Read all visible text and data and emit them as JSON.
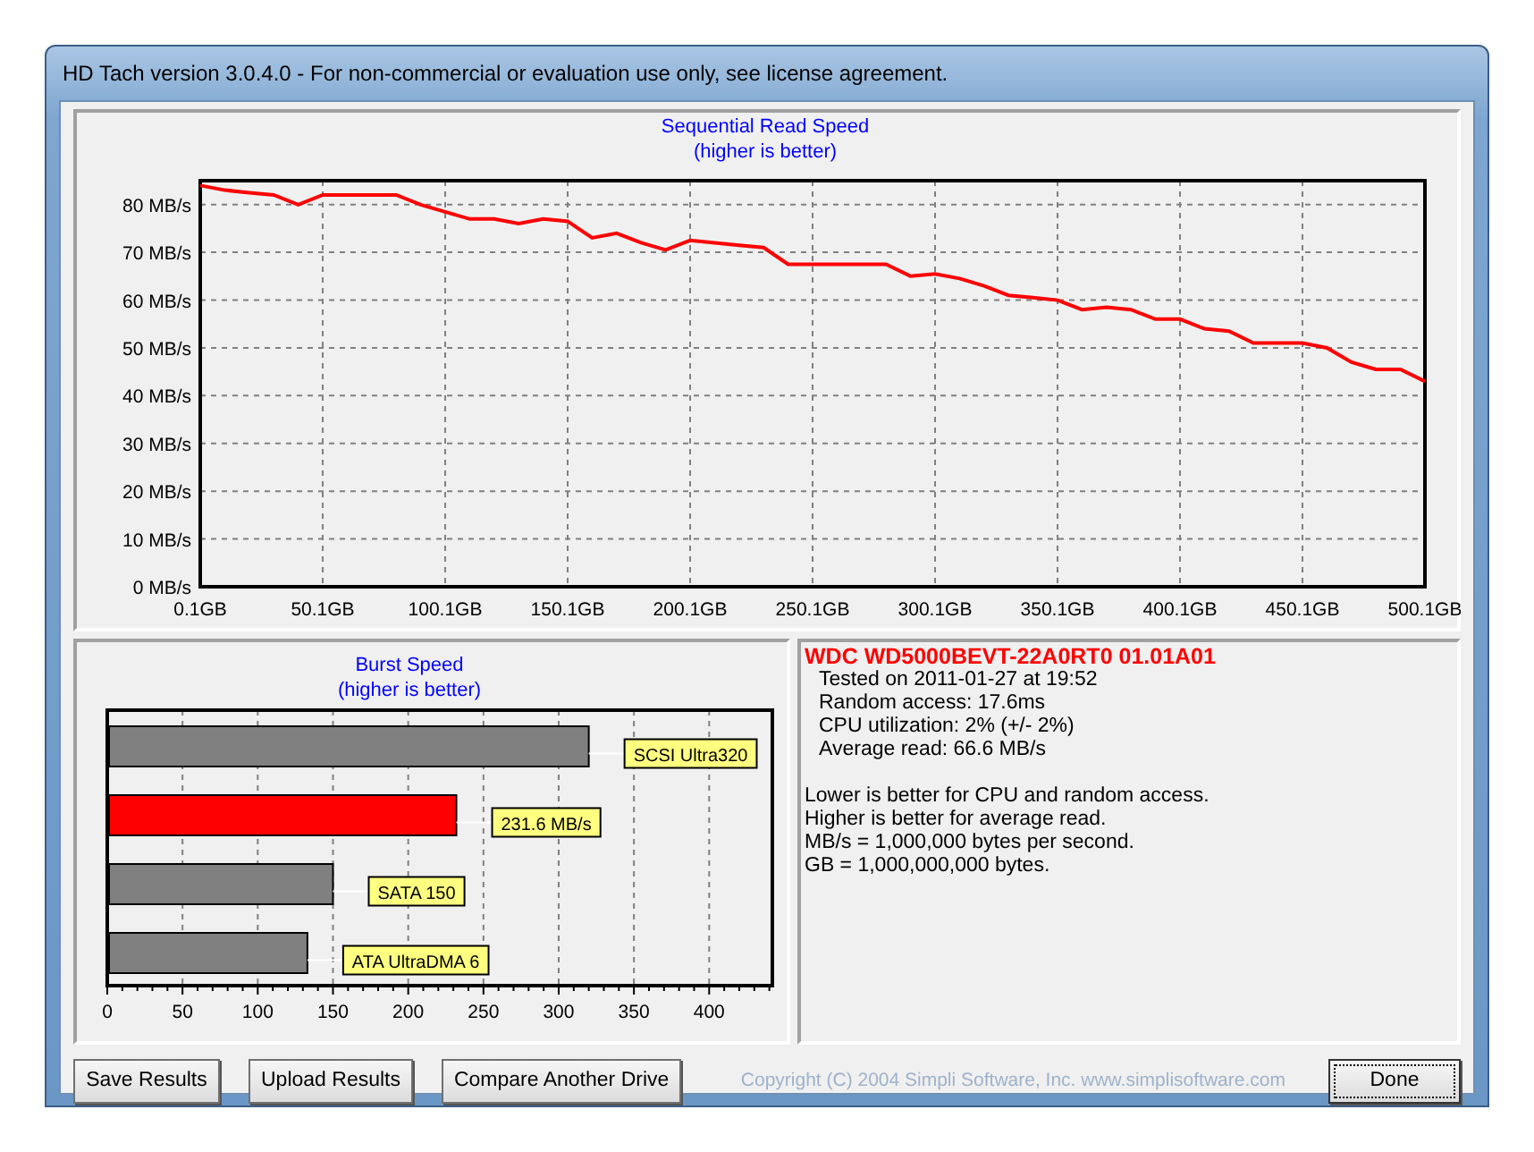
{
  "window": {
    "title": "HD Tach version 3.0.4.0  - For non-commercial or evaluation use only, see license agreement."
  },
  "read_chart": {
    "subtitle": "(higher is better)",
    "chart_data": {
      "type": "line",
      "title": "Sequential Read Speed",
      "x": [
        0.1,
        10.1,
        20.1,
        30.1,
        40.1,
        50.1,
        60.1,
        70.1,
        80.1,
        90.1,
        100.1,
        110.1,
        120.1,
        130.1,
        140.1,
        150.1,
        160.1,
        170.1,
        180.1,
        190.1,
        200.1,
        210.1,
        220.1,
        230.1,
        240.1,
        250.1,
        260.1,
        270.1,
        280.1,
        290.1,
        300.1,
        310.1,
        320.1,
        330.1,
        340.1,
        350.1,
        360.1,
        370.1,
        380.1,
        390.1,
        400.1,
        410.1,
        420.1,
        430.1,
        440.1,
        450.1,
        460.1,
        470.1,
        480.1,
        490.1,
        500.1
      ],
      "series": [
        {
          "color": "#ff0000",
          "values": [
            84,
            83,
            82.5,
            82,
            80,
            82,
            82,
            82,
            82,
            80,
            78.5,
            77,
            77,
            76,
            77,
            76.5,
            73,
            74,
            72,
            70.5,
            72.5,
            72,
            71.5,
            71,
            67.5,
            67.5,
            67.5,
            67.5,
            67.5,
            65,
            65.5,
            64.5,
            63,
            61,
            60.5,
            60,
            58,
            58.5,
            58,
            56,
            56,
            54,
            53.5,
            51,
            51,
            51,
            50,
            47,
            45.5,
            45.5,
            43
          ]
        }
      ],
      "xlim": [
        0.1,
        500.1
      ],
      "ylim": [
        0,
        85
      ],
      "grid": true,
      "xticks": [
        {
          "value": 0.1,
          "label": "0.1GB"
        },
        {
          "value": 50.1,
          "label": "50.1GB"
        },
        {
          "value": 100.1,
          "label": "100.1GB"
        },
        {
          "value": 150.1,
          "label": "150.1GB"
        },
        {
          "value": 200.1,
          "label": "200.1GB"
        },
        {
          "value": 250.1,
          "label": "250.1GB"
        },
        {
          "value": 300.1,
          "label": "300.1GB"
        },
        {
          "value": 350.1,
          "label": "350.1GB"
        },
        {
          "value": 400.1,
          "label": "400.1GB"
        },
        {
          "value": 450.1,
          "label": "450.1GB"
        },
        {
          "value": 500.1,
          "label": "500.1GB"
        }
      ],
      "yticks": [
        {
          "value": 0,
          "label": "0 MB/s"
        },
        {
          "value": 10,
          "label": "10 MB/s"
        },
        {
          "value": 20,
          "label": "20 MB/s"
        },
        {
          "value": 30,
          "label": "30 MB/s"
        },
        {
          "value": 40,
          "label": "40 MB/s"
        },
        {
          "value": 50,
          "label": "50 MB/s"
        },
        {
          "value": 60,
          "label": "60 MB/s"
        },
        {
          "value": 70,
          "label": "70 MB/s"
        },
        {
          "value": 80,
          "label": "80 MB/s"
        }
      ]
    }
  },
  "burst_chart": {
    "subtitle": "(higher is better)",
    "chart_data": {
      "type": "bar",
      "orientation": "horizontal",
      "grid": true,
      "title": "Burst Speed",
      "categories": [
        "SCSI Ultra320",
        "231.6 MB/s",
        "SATA 150",
        "ATA UltraDMA 6"
      ],
      "series": [
        {
          "color": "#808080",
          "values": [
            320,
            null,
            150,
            133
          ]
        },
        {
          "color": "#ff0000",
          "values": [
            null,
            232,
            null,
            null
          ]
        }
      ],
      "xlim": [
        0,
        442
      ],
      "xticks": [
        0,
        50,
        100,
        150,
        200,
        250,
        300,
        350,
        400
      ]
    }
  },
  "info": {
    "drive": "WDC WD5000BEVT-22A0RT0 01.01A01",
    "details": [
      "Tested on 2011-01-27 at 19:52",
      "Random access: 17.6ms",
      "CPU utilization: 2% (+/- 2%)",
      "Average read: 66.6 MB/s"
    ],
    "notes": [
      "Lower is better for CPU and random access.",
      "Higher is better for average read.",
      "MB/s = 1,000,000 bytes per second.",
      "GB = 1,000,000,000 bytes."
    ]
  },
  "buttons": [
    {
      "label": "Save Results",
      "default": false
    },
    {
      "label": "Upload Results",
      "default": false
    },
    {
      "label": "Compare Another Drive",
      "default": false
    }
  ],
  "copyright": "Copyright (C) 2004 Simpli Software, Inc. www.simplisoftware.com",
  "close_button": {
    "label": "Done",
    "default": true
  }
}
